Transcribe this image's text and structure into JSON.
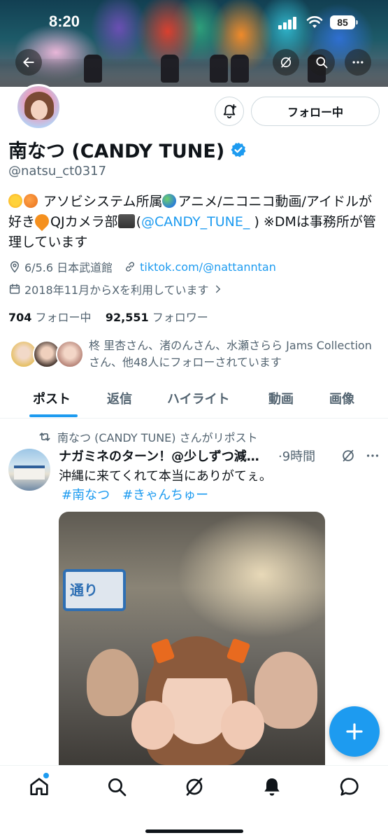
{
  "status_bar": {
    "time": "8:20",
    "battery": "85"
  },
  "header": {
    "back_icon": "back-arrow-icon",
    "grok_icon": "grok-icon",
    "search_icon": "search-icon",
    "more_icon": "more-icon"
  },
  "profile": {
    "name": "南なつ (CANDY TUNE)",
    "verified": true,
    "handle": "@natsu_ct0317",
    "follow_button": "フォロー中",
    "bio_part1": " アソビシステム所属",
    "bio_part2": "アニメ/ニコニコ動画/アイドルが好き",
    "bio_part3": "QJカメラ部",
    "bio_part4": "(",
    "bio_mention": "@CANDY_TUNE_",
    "bio_part5": " ) ※DMは事務所が管理しています",
    "location": "6/5.6 日本武道館",
    "website": "tiktok.com/@nattanntan",
    "joined": "2018年11月からXを利用しています",
    "following_count": "704",
    "following_label": "フォロー中",
    "followers_count": "92,551",
    "followers_label": "フォロワー",
    "followed_by": "柊 里杏さん、渚のんさん、水瀬さらら Jams Collectionさん、他48人にフォローされています"
  },
  "tabs": [
    "ポスト",
    "返信",
    "ハイライト",
    "動画",
    "画像"
  ],
  "post": {
    "repost_label": "南なつ (CANDY TUNE) さんがリポスト",
    "author": "ナガミネのターン！@少しずつ減…",
    "time": "·9時間",
    "text": "沖縄に来てくれて本当にありがてぇ。",
    "hashtags": [
      "#南なつ",
      "#きゃんちゅー"
    ],
    "image_sign_text": "通り"
  },
  "colors": {
    "accent": "#1d9bf0",
    "text": "#0f1419",
    "secondary": "#536471"
  }
}
